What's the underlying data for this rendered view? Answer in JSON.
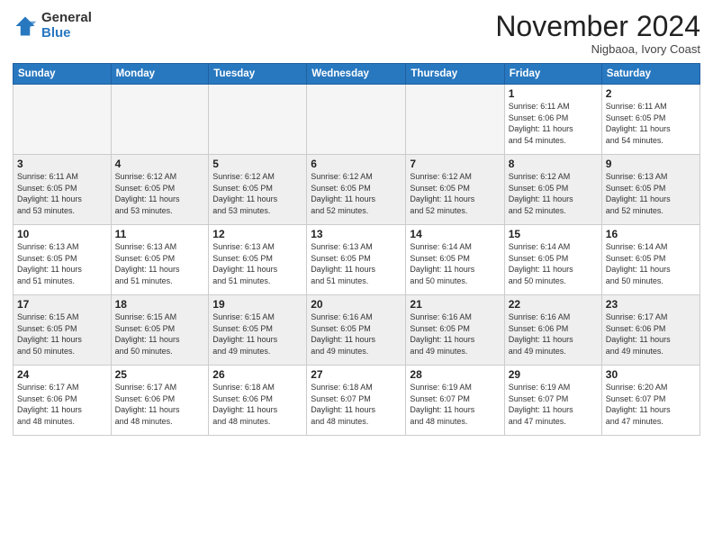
{
  "logo": {
    "general": "General",
    "blue": "Blue"
  },
  "header": {
    "month": "November 2024",
    "location": "Nigbaoa, Ivory Coast"
  },
  "weekdays": [
    "Sunday",
    "Monday",
    "Tuesday",
    "Wednesday",
    "Thursday",
    "Friday",
    "Saturday"
  ],
  "weeks": [
    [
      {
        "day": "",
        "info": ""
      },
      {
        "day": "",
        "info": ""
      },
      {
        "day": "",
        "info": ""
      },
      {
        "day": "",
        "info": ""
      },
      {
        "day": "",
        "info": ""
      },
      {
        "day": "1",
        "info": "Sunrise: 6:11 AM\nSunset: 6:06 PM\nDaylight: 11 hours\nand 54 minutes."
      },
      {
        "day": "2",
        "info": "Sunrise: 6:11 AM\nSunset: 6:05 PM\nDaylight: 11 hours\nand 54 minutes."
      }
    ],
    [
      {
        "day": "3",
        "info": "Sunrise: 6:11 AM\nSunset: 6:05 PM\nDaylight: 11 hours\nand 53 minutes."
      },
      {
        "day": "4",
        "info": "Sunrise: 6:12 AM\nSunset: 6:05 PM\nDaylight: 11 hours\nand 53 minutes."
      },
      {
        "day": "5",
        "info": "Sunrise: 6:12 AM\nSunset: 6:05 PM\nDaylight: 11 hours\nand 53 minutes."
      },
      {
        "day": "6",
        "info": "Sunrise: 6:12 AM\nSunset: 6:05 PM\nDaylight: 11 hours\nand 52 minutes."
      },
      {
        "day": "7",
        "info": "Sunrise: 6:12 AM\nSunset: 6:05 PM\nDaylight: 11 hours\nand 52 minutes."
      },
      {
        "day": "8",
        "info": "Sunrise: 6:12 AM\nSunset: 6:05 PM\nDaylight: 11 hours\nand 52 minutes."
      },
      {
        "day": "9",
        "info": "Sunrise: 6:13 AM\nSunset: 6:05 PM\nDaylight: 11 hours\nand 52 minutes."
      }
    ],
    [
      {
        "day": "10",
        "info": "Sunrise: 6:13 AM\nSunset: 6:05 PM\nDaylight: 11 hours\nand 51 minutes."
      },
      {
        "day": "11",
        "info": "Sunrise: 6:13 AM\nSunset: 6:05 PM\nDaylight: 11 hours\nand 51 minutes."
      },
      {
        "day": "12",
        "info": "Sunrise: 6:13 AM\nSunset: 6:05 PM\nDaylight: 11 hours\nand 51 minutes."
      },
      {
        "day": "13",
        "info": "Sunrise: 6:13 AM\nSunset: 6:05 PM\nDaylight: 11 hours\nand 51 minutes."
      },
      {
        "day": "14",
        "info": "Sunrise: 6:14 AM\nSunset: 6:05 PM\nDaylight: 11 hours\nand 50 minutes."
      },
      {
        "day": "15",
        "info": "Sunrise: 6:14 AM\nSunset: 6:05 PM\nDaylight: 11 hours\nand 50 minutes."
      },
      {
        "day": "16",
        "info": "Sunrise: 6:14 AM\nSunset: 6:05 PM\nDaylight: 11 hours\nand 50 minutes."
      }
    ],
    [
      {
        "day": "17",
        "info": "Sunrise: 6:15 AM\nSunset: 6:05 PM\nDaylight: 11 hours\nand 50 minutes."
      },
      {
        "day": "18",
        "info": "Sunrise: 6:15 AM\nSunset: 6:05 PM\nDaylight: 11 hours\nand 50 minutes."
      },
      {
        "day": "19",
        "info": "Sunrise: 6:15 AM\nSunset: 6:05 PM\nDaylight: 11 hours\nand 49 minutes."
      },
      {
        "day": "20",
        "info": "Sunrise: 6:16 AM\nSunset: 6:05 PM\nDaylight: 11 hours\nand 49 minutes."
      },
      {
        "day": "21",
        "info": "Sunrise: 6:16 AM\nSunset: 6:05 PM\nDaylight: 11 hours\nand 49 minutes."
      },
      {
        "day": "22",
        "info": "Sunrise: 6:16 AM\nSunset: 6:06 PM\nDaylight: 11 hours\nand 49 minutes."
      },
      {
        "day": "23",
        "info": "Sunrise: 6:17 AM\nSunset: 6:06 PM\nDaylight: 11 hours\nand 49 minutes."
      }
    ],
    [
      {
        "day": "24",
        "info": "Sunrise: 6:17 AM\nSunset: 6:06 PM\nDaylight: 11 hours\nand 48 minutes."
      },
      {
        "day": "25",
        "info": "Sunrise: 6:17 AM\nSunset: 6:06 PM\nDaylight: 11 hours\nand 48 minutes."
      },
      {
        "day": "26",
        "info": "Sunrise: 6:18 AM\nSunset: 6:06 PM\nDaylight: 11 hours\nand 48 minutes."
      },
      {
        "day": "27",
        "info": "Sunrise: 6:18 AM\nSunset: 6:07 PM\nDaylight: 11 hours\nand 48 minutes."
      },
      {
        "day": "28",
        "info": "Sunrise: 6:19 AM\nSunset: 6:07 PM\nDaylight: 11 hours\nand 48 minutes."
      },
      {
        "day": "29",
        "info": "Sunrise: 6:19 AM\nSunset: 6:07 PM\nDaylight: 11 hours\nand 47 minutes."
      },
      {
        "day": "30",
        "info": "Sunrise: 6:20 AM\nSunset: 6:07 PM\nDaylight: 11 hours\nand 47 minutes."
      }
    ]
  ]
}
